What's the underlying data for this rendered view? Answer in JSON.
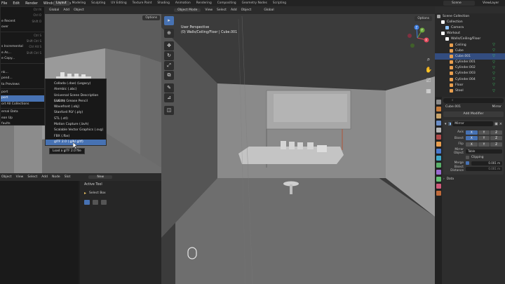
{
  "topbar": {
    "menu": [
      "File",
      "Edit",
      "Render",
      "Window",
      "Help"
    ],
    "workspaces": [
      "Layout",
      "Modeling",
      "Sculpting",
      "UV Editing",
      "Texture Paint",
      "Shading",
      "Animation",
      "Rendering",
      "Compositing",
      "Geometry Nodes",
      "Scripting"
    ],
    "active_workspace": "Layout",
    "scene": "Scene",
    "view_layer": "ViewLayer"
  },
  "left_view": {
    "header": [
      "Add",
      "Object"
    ],
    "transform": "Global",
    "options": "Options"
  },
  "file_menu": {
    "items": [
      {
        "label": "",
        "shortcut": "Ctrl N"
      },
      {
        "label": "",
        "shortcut": "Ctrl O"
      },
      {
        "label": "e Recent",
        "shortcut": "Shift O"
      },
      {
        "label": "over",
        "shortcut": ""
      },
      {
        "label": "",
        "shortcut": "Ctrl S"
      },
      {
        "label": "",
        "shortcut": "Shift Ctrl S"
      },
      {
        "label": "s Incremental",
        "shortcut": "Ctrl Alt S"
      },
      {
        "label": "e As...",
        "shortcut": "Shift Ctrl S"
      },
      {
        "label": "e Copy...",
        "shortcut": ""
      },
      {
        "label": "",
        "shortcut": ""
      },
      {
        "label": "nk...",
        "shortcut": ""
      },
      {
        "label": "pend...",
        "shortcut": ""
      },
      {
        "label": "ta Previews",
        "shortcut": ""
      },
      {
        "label": "port",
        "shortcut": ""
      },
      {
        "label": "port",
        "shortcut": ""
      },
      {
        "label": "ort All Collections",
        "shortcut": ""
      },
      {
        "label": "ernal Data",
        "shortcut": ""
      },
      {
        "label": "ean Up",
        "shortcut": ""
      },
      {
        "label": "faults",
        "shortcut": ""
      }
    ],
    "highlight_index": 14
  },
  "export_menu": {
    "items": [
      "Collada (.dae) (Legacy)",
      "Alembic (.abc)",
      "Universal Scene Description (.usd*)",
      "SVG as Grease Pencil",
      "Wavefront (.obj)",
      "Stanford PLY (.ply)",
      "STL (.stl)",
      "Motion Capture (.bvh)",
      "Scalable Vector Graphics (.svg)",
      "FBX (.fbx)",
      "glTF 2.0 (.glb/.gltf)"
    ],
    "highlight_index": 10,
    "tooltip": "Load a glTF 2.0 file"
  },
  "bottom_left": {
    "header": [
      "Object",
      "View",
      "Select",
      "Add",
      "Node",
      "Slot"
    ],
    "new_button": "New",
    "active_tool_title": "Active Tool",
    "select_box": "Select Box"
  },
  "viewport": {
    "header": [
      "Object Mode",
      "View",
      "Select",
      "Add",
      "Object"
    ],
    "transform": "Global",
    "label_line1": "User Perspective",
    "label_line2": "(0) Walls/Ceiling/Floor | Cube.001",
    "options": "Options"
  },
  "gizmo": {
    "x": "X",
    "y": "Y",
    "z": "Z"
  },
  "outliner": {
    "rows": [
      {
        "label": "Scene Collection",
        "indent": 0,
        "color": "#a3a3a3",
        "hl": false
      },
      {
        "label": "Collection",
        "indent": 1,
        "color": "#ffffff",
        "hl": false
      },
      {
        "label": "Camera",
        "indent": 2,
        "color": "#8ec3ff",
        "hl": false
      },
      {
        "label": "Workout",
        "indent": 1,
        "color": "#ffffff",
        "hl": false
      },
      {
        "label": "Walls/Ceiling/Floor",
        "indent": 2,
        "color": "#ffffff",
        "hl": false
      },
      {
        "label": "Ceiling",
        "indent": 3,
        "color": "#e89e4e",
        "hl": false
      },
      {
        "label": "Cube",
        "indent": 3,
        "color": "#e89e4e",
        "hl": false
      },
      {
        "label": "Cube.001",
        "indent": 3,
        "color": "#e89e4e",
        "hl": true
      },
      {
        "label": "Cylinder.001",
        "indent": 3,
        "color": "#e89e4e",
        "hl": false
      },
      {
        "label": "Cylinder.002",
        "indent": 3,
        "color": "#e89e4e",
        "hl": false
      },
      {
        "label": "Cylinder.003",
        "indent": 3,
        "color": "#e89e4e",
        "hl": false
      },
      {
        "label": "Cylinder.004",
        "indent": 3,
        "color": "#e89e4e",
        "hl": false
      },
      {
        "label": "Floor",
        "indent": 3,
        "color": "#e89e4e",
        "hl": false
      },
      {
        "label": "Stool",
        "indent": 3,
        "color": "#e89e4e",
        "hl": false
      }
    ]
  },
  "properties": {
    "object": "Cube.001",
    "modifier_type": "Mirror",
    "add_modifier": "Add Modifier",
    "modifier_name": "Mirror",
    "axis_label": "Axis",
    "bisect_label": "Bisect",
    "flip_label": "Flip",
    "axes": [
      "X",
      "Y",
      "Z"
    ],
    "mirror_object_label": "Mirror Object",
    "mirror_object": "Table",
    "clipping": "Clipping",
    "merge_label": "Merge",
    "merge_value": "0.001 m",
    "bisect_distance_label": "Bisect Distance",
    "bisect_distance": "0.001 m",
    "data": "Data"
  }
}
